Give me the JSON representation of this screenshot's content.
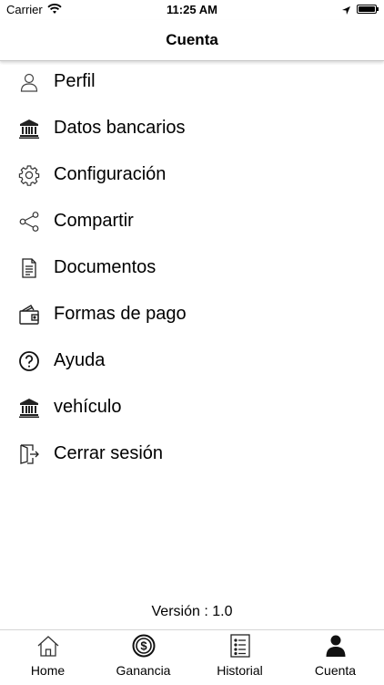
{
  "status_bar": {
    "carrier": "Carrier",
    "time": "11:25 AM"
  },
  "nav": {
    "title": "Cuenta"
  },
  "menu": {
    "items": [
      {
        "label": "Perfil",
        "icon": "person-icon"
      },
      {
        "label": "Datos bancarios",
        "icon": "bank-icon"
      },
      {
        "label": "Configuración",
        "icon": "gear-icon"
      },
      {
        "label": "Compartir",
        "icon": "share-icon"
      },
      {
        "label": "Documentos",
        "icon": "document-icon"
      },
      {
        "label": "Formas de pago",
        "icon": "wallet-icon"
      },
      {
        "label": "Ayuda",
        "icon": "help-icon"
      },
      {
        "label": "vehículo",
        "icon": "bank-icon"
      },
      {
        "label": "Cerrar sesión",
        "icon": "logout-icon"
      }
    ]
  },
  "footer": {
    "version": "Versión : 1.0"
  },
  "tab_bar": {
    "tabs": [
      {
        "label": "Home",
        "icon": "home-icon"
      },
      {
        "label": "Ganancia",
        "icon": "dollar-coin-icon"
      },
      {
        "label": "Historial",
        "icon": "list-icon"
      },
      {
        "label": "Cuenta",
        "icon": "person-filled-icon"
      }
    ]
  }
}
